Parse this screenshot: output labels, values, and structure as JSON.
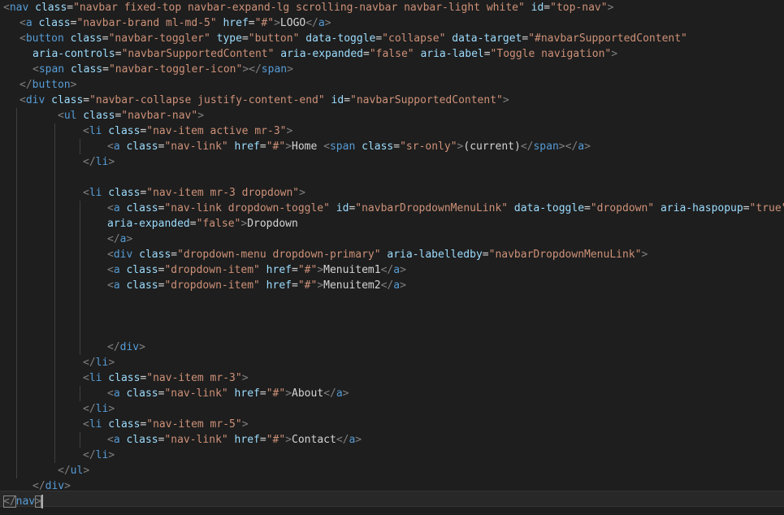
{
  "editor": {
    "lines": [
      {
        "indent": 0,
        "guides": [],
        "tokens": [
          [
            "p",
            "<"
          ],
          [
            "t",
            "nav"
          ],
          [
            "a",
            " class"
          ],
          [
            "x",
            "="
          ],
          [
            "s",
            "\"navbar fixed-top navbar-expand-lg scrolling-navbar navbar-light white\""
          ],
          [
            "a",
            " id"
          ],
          [
            "x",
            "="
          ],
          [
            "s",
            "\"top-nav\""
          ],
          [
            "p",
            ">"
          ]
        ]
      },
      {
        "indent": 20,
        "guides": [],
        "tokens": [
          [
            "p",
            "<"
          ],
          [
            "t",
            "a"
          ],
          [
            "a",
            " class"
          ],
          [
            "x",
            "="
          ],
          [
            "s",
            "\"navbar-brand ml-md-5\""
          ],
          [
            "a",
            " href"
          ],
          [
            "x",
            "="
          ],
          [
            "s",
            "\"#\""
          ],
          [
            "p",
            ">"
          ],
          [
            "x",
            "LOGO"
          ],
          [
            "p",
            "</"
          ],
          [
            "t",
            "a"
          ],
          [
            "p",
            ">"
          ]
        ]
      },
      {
        "indent": 20,
        "guides": [],
        "tokens": [
          [
            "p",
            "<"
          ],
          [
            "t",
            "button"
          ],
          [
            "a",
            " class"
          ],
          [
            "x",
            "="
          ],
          [
            "s",
            "\"navbar-toggler\""
          ],
          [
            "a",
            " type"
          ],
          [
            "x",
            "="
          ],
          [
            "s",
            "\"button\""
          ],
          [
            "a",
            " data-toggle"
          ],
          [
            "x",
            "="
          ],
          [
            "s",
            "\"collapse\""
          ],
          [
            "a",
            " data-target"
          ],
          [
            "x",
            "="
          ],
          [
            "s",
            "\"#navbarSupportedContent\""
          ]
        ]
      },
      {
        "indent": 36,
        "guides": [],
        "tokens": [
          [
            "a",
            "aria-controls"
          ],
          [
            "x",
            "="
          ],
          [
            "s",
            "\"navbarSupportedContent\""
          ],
          [
            "a",
            " aria-expanded"
          ],
          [
            "x",
            "="
          ],
          [
            "s",
            "\"false\""
          ],
          [
            "a",
            " aria-label"
          ],
          [
            "x",
            "="
          ],
          [
            "s",
            "\"Toggle navigation\""
          ],
          [
            "p",
            ">"
          ]
        ]
      },
      {
        "indent": 36,
        "guides": [],
        "tokens": [
          [
            "p",
            "<"
          ],
          [
            "t",
            "span"
          ],
          [
            "a",
            " class"
          ],
          [
            "x",
            "="
          ],
          [
            "s",
            "\"navbar-toggler-icon\""
          ],
          [
            "p",
            ">"
          ],
          [
            "p",
            "</"
          ],
          [
            "t",
            "span"
          ],
          [
            "p",
            ">"
          ]
        ]
      },
      {
        "indent": 20,
        "guides": [],
        "tokens": [
          [
            "p",
            "</"
          ],
          [
            "t",
            "button"
          ],
          [
            "p",
            ">"
          ]
        ]
      },
      {
        "indent": 20,
        "guides": [],
        "tokens": [
          [
            "p",
            "<"
          ],
          [
            "t",
            "div"
          ],
          [
            "a",
            " class"
          ],
          [
            "x",
            "="
          ],
          [
            "s",
            "\"navbar-collapse justify-content-end\""
          ],
          [
            "a",
            " id"
          ],
          [
            "x",
            "="
          ],
          [
            "s",
            "\"navbarSupportedContent\""
          ],
          [
            "p",
            ">"
          ]
        ]
      },
      {
        "indent": 67,
        "guides": [
          20
        ],
        "tokens": [
          [
            "p",
            "<"
          ],
          [
            "t",
            "ul"
          ],
          [
            "a",
            " class"
          ],
          [
            "x",
            "="
          ],
          [
            "s",
            "\"navbar-nav\""
          ],
          [
            "p",
            ">"
          ]
        ]
      },
      {
        "indent": 98,
        "guides": [
          20,
          67
        ],
        "tokens": [
          [
            "p",
            "<"
          ],
          [
            "t",
            "li"
          ],
          [
            "a",
            " class"
          ],
          [
            "x",
            "="
          ],
          [
            "s",
            "\"nav-item active mr-3\""
          ],
          [
            "p",
            ">"
          ]
        ]
      },
      {
        "indent": 128,
        "guides": [
          20,
          67,
          98
        ],
        "tokens": [
          [
            "p",
            "<"
          ],
          [
            "t",
            "a"
          ],
          [
            "a",
            " class"
          ],
          [
            "x",
            "="
          ],
          [
            "s",
            "\"nav-link\""
          ],
          [
            "a",
            " href"
          ],
          [
            "x",
            "="
          ],
          [
            "s",
            "\"#\""
          ],
          [
            "p",
            ">"
          ],
          [
            "x",
            "Home "
          ],
          [
            "p",
            "<"
          ],
          [
            "t",
            "span"
          ],
          [
            "a",
            " class"
          ],
          [
            "x",
            "="
          ],
          [
            "s",
            "\"sr-only\""
          ],
          [
            "p",
            ">"
          ],
          [
            "x",
            "(current)"
          ],
          [
            "p",
            "</"
          ],
          [
            "t",
            "span"
          ],
          [
            "p",
            ">"
          ],
          [
            "p",
            "</"
          ],
          [
            "t",
            "a"
          ],
          [
            "p",
            ">"
          ]
        ]
      },
      {
        "indent": 98,
        "guides": [
          20,
          67
        ],
        "tokens": [
          [
            "p",
            "</"
          ],
          [
            "t",
            "li"
          ],
          [
            "p",
            ">"
          ]
        ]
      },
      {
        "indent": 0,
        "guides": [
          20,
          67
        ],
        "tokens": []
      },
      {
        "indent": 98,
        "guides": [
          20,
          67
        ],
        "tokens": [
          [
            "p",
            "<"
          ],
          [
            "t",
            "li"
          ],
          [
            "a",
            " class"
          ],
          [
            "x",
            "="
          ],
          [
            "s",
            "\"nav-item mr-3 dropdown\""
          ],
          [
            "p",
            ">"
          ]
        ]
      },
      {
        "indent": 128,
        "guides": [
          20,
          67,
          98
        ],
        "tokens": [
          [
            "p",
            "<"
          ],
          [
            "t",
            "a"
          ],
          [
            "a",
            " class"
          ],
          [
            "x",
            "="
          ],
          [
            "s",
            "\"nav-link dropdown-toggle\""
          ],
          [
            "a",
            " id"
          ],
          [
            "x",
            "="
          ],
          [
            "s",
            "\"navbarDropdownMenuLink\""
          ],
          [
            "a",
            " data-toggle"
          ],
          [
            "x",
            "="
          ],
          [
            "s",
            "\"dropdown\""
          ],
          [
            "a",
            " aria-haspopup"
          ],
          [
            "x",
            "="
          ],
          [
            "s",
            "\"true\""
          ]
        ]
      },
      {
        "indent": 128,
        "guides": [
          20,
          67,
          98
        ],
        "tokens": [
          [
            "a",
            "aria-expanded"
          ],
          [
            "x",
            "="
          ],
          [
            "s",
            "\"false\""
          ],
          [
            "p",
            ">"
          ],
          [
            "x",
            "Dropdown"
          ]
        ]
      },
      {
        "indent": 128,
        "guides": [
          20,
          67,
          98
        ],
        "tokens": [
          [
            "p",
            "</"
          ],
          [
            "t",
            "a"
          ],
          [
            "p",
            ">"
          ]
        ]
      },
      {
        "indent": 128,
        "guides": [
          20,
          67,
          98
        ],
        "tokens": [
          [
            "p",
            "<"
          ],
          [
            "t",
            "div"
          ],
          [
            "a",
            " class"
          ],
          [
            "x",
            "="
          ],
          [
            "s",
            "\"dropdown-menu dropdown-primary\""
          ],
          [
            "a",
            " aria-labelledby"
          ],
          [
            "x",
            "="
          ],
          [
            "s",
            "\"navbarDropdownMenuLink\""
          ],
          [
            "p",
            ">"
          ]
        ]
      },
      {
        "indent": 128,
        "guides": [
          20,
          67,
          98
        ],
        "tokens": [
          [
            "p",
            "<"
          ],
          [
            "t",
            "a"
          ],
          [
            "a",
            " class"
          ],
          [
            "x",
            "="
          ],
          [
            "s",
            "\"dropdown-item\""
          ],
          [
            "a",
            " href"
          ],
          [
            "x",
            "="
          ],
          [
            "s",
            "\"#\""
          ],
          [
            "p",
            ">"
          ],
          [
            "x",
            "Menuitem1"
          ],
          [
            "p",
            "</"
          ],
          [
            "t",
            "a"
          ],
          [
            "p",
            ">"
          ]
        ]
      },
      {
        "indent": 128,
        "guides": [
          20,
          67,
          98
        ],
        "tokens": [
          [
            "p",
            "<"
          ],
          [
            "t",
            "a"
          ],
          [
            "a",
            " class"
          ],
          [
            "x",
            "="
          ],
          [
            "s",
            "\"dropdown-item\""
          ],
          [
            "a",
            " href"
          ],
          [
            "x",
            "="
          ],
          [
            "s",
            "\"#\""
          ],
          [
            "p",
            ">"
          ],
          [
            "x",
            "Menuitem2"
          ],
          [
            "p",
            "</"
          ],
          [
            "t",
            "a"
          ],
          [
            "p",
            ">"
          ]
        ]
      },
      {
        "indent": 0,
        "guides": [
          20,
          67,
          98
        ],
        "tokens": []
      },
      {
        "indent": 0,
        "guides": [
          20,
          67,
          98
        ],
        "tokens": []
      },
      {
        "indent": 0,
        "guides": [
          20,
          67,
          98
        ],
        "tokens": []
      },
      {
        "indent": 128,
        "guides": [
          20,
          67,
          98
        ],
        "tokens": [
          [
            "p",
            "</"
          ],
          [
            "t",
            "div"
          ],
          [
            "p",
            ">"
          ]
        ]
      },
      {
        "indent": 98,
        "guides": [
          20,
          67
        ],
        "tokens": [
          [
            "p",
            "</"
          ],
          [
            "t",
            "li"
          ],
          [
            "p",
            ">"
          ]
        ]
      },
      {
        "indent": 98,
        "guides": [
          20,
          67
        ],
        "tokens": [
          [
            "p",
            "<"
          ],
          [
            "t",
            "li"
          ],
          [
            "a",
            " class"
          ],
          [
            "x",
            "="
          ],
          [
            "s",
            "\"nav-item mr-3\""
          ],
          [
            "p",
            ">"
          ]
        ]
      },
      {
        "indent": 128,
        "guides": [
          20,
          67,
          98
        ],
        "tokens": [
          [
            "p",
            "<"
          ],
          [
            "t",
            "a"
          ],
          [
            "a",
            " class"
          ],
          [
            "x",
            "="
          ],
          [
            "s",
            "\"nav-link\""
          ],
          [
            "a",
            " href"
          ],
          [
            "x",
            "="
          ],
          [
            "s",
            "\"#\""
          ],
          [
            "p",
            ">"
          ],
          [
            "x",
            "About"
          ],
          [
            "p",
            "</"
          ],
          [
            "t",
            "a"
          ],
          [
            "p",
            ">"
          ]
        ]
      },
      {
        "indent": 98,
        "guides": [
          20,
          67
        ],
        "tokens": [
          [
            "p",
            "</"
          ],
          [
            "t",
            "li"
          ],
          [
            "p",
            ">"
          ]
        ]
      },
      {
        "indent": 98,
        "guides": [
          20,
          67
        ],
        "tokens": [
          [
            "p",
            "<"
          ],
          [
            "t",
            "li"
          ],
          [
            "a",
            " class"
          ],
          [
            "x",
            "="
          ],
          [
            "s",
            "\"nav-item mr-5\""
          ],
          [
            "p",
            ">"
          ]
        ]
      },
      {
        "indent": 128,
        "guides": [
          20,
          67,
          98
        ],
        "tokens": [
          [
            "p",
            "<"
          ],
          [
            "t",
            "a"
          ],
          [
            "a",
            " class"
          ],
          [
            "x",
            "="
          ],
          [
            "s",
            "\"nav-link\""
          ],
          [
            "a",
            " href"
          ],
          [
            "x",
            "="
          ],
          [
            "s",
            "\"#\""
          ],
          [
            "p",
            ">"
          ],
          [
            "x",
            "Contact"
          ],
          [
            "p",
            "</"
          ],
          [
            "t",
            "a"
          ],
          [
            "p",
            ">"
          ]
        ]
      },
      {
        "indent": 98,
        "guides": [
          20,
          67
        ],
        "tokens": [
          [
            "p",
            "</"
          ],
          [
            "t",
            "li"
          ],
          [
            "p",
            ">"
          ]
        ]
      },
      {
        "indent": 67,
        "guides": [
          20
        ],
        "tokens": [
          [
            "p",
            "</"
          ],
          [
            "t",
            "ul"
          ],
          [
            "p",
            ">"
          ]
        ]
      },
      {
        "indent": 36,
        "guides": [],
        "tokens": [
          [
            "p",
            "</"
          ],
          [
            "t",
            "div"
          ],
          [
            "p",
            ">"
          ]
        ]
      },
      {
        "indent": 0,
        "guides": [],
        "tokens": [
          [
            "p",
            "</"
          ],
          [
            "t",
            "nav"
          ],
          [
            "p",
            ">"
          ]
        ],
        "cursor": true
      }
    ]
  }
}
